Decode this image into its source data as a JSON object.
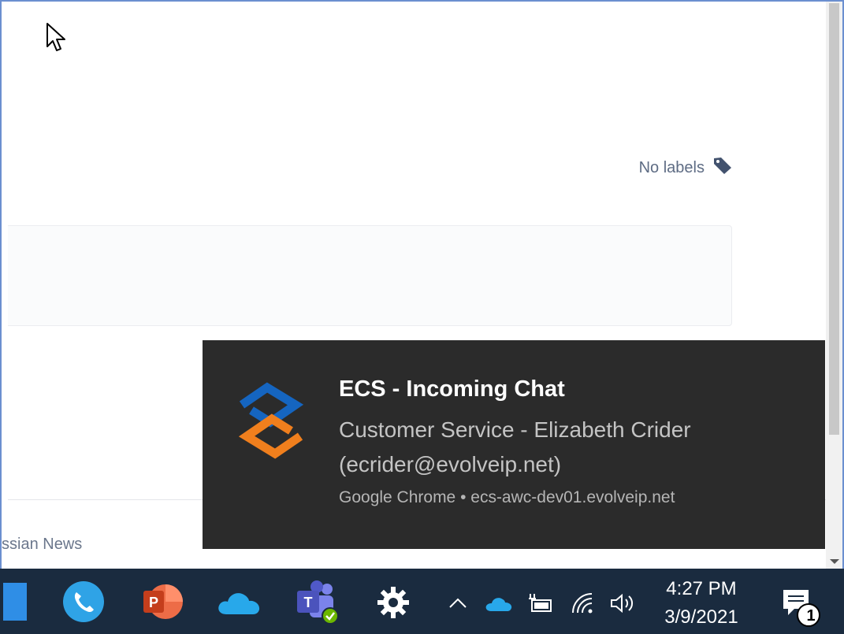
{
  "page": {
    "labels_text": "No labels",
    "footer_text": "ssian News"
  },
  "notification": {
    "title": "ECS - Incoming Chat",
    "body_line1": "Customer Service - Elizabeth Crider",
    "body_line2": "(ecrider@evolveip.net)",
    "source": "Google Chrome • ecs-awc-dev01.evolveip.net",
    "logo_icon": "ecs-logo-icon",
    "colors": {
      "background": "#2b2b2b",
      "logo_blue": "#1565c0",
      "logo_orange": "#f07f1d"
    }
  },
  "taskbar": {
    "apps": [
      {
        "name": "start",
        "icon": "windows-start-icon"
      },
      {
        "name": "phone",
        "icon": "phone-icon"
      },
      {
        "name": "powerpoint",
        "icon": "powerpoint-icon",
        "letter": "P"
      },
      {
        "name": "onedrive",
        "icon": "onedrive-cloud-icon"
      },
      {
        "name": "teams",
        "icon": "teams-icon",
        "letter": "T"
      },
      {
        "name": "settings",
        "icon": "gear-icon"
      }
    ],
    "tray": [
      "chevron-up-icon",
      "onedrive-tray-icon",
      "battery-icon",
      "wifi-icon",
      "volume-icon"
    ],
    "clock": {
      "time": "4:27 PM",
      "date": "3/9/2021"
    },
    "notifications": {
      "icon": "action-center-icon",
      "count": "1"
    },
    "color": "#1a2b3f"
  }
}
